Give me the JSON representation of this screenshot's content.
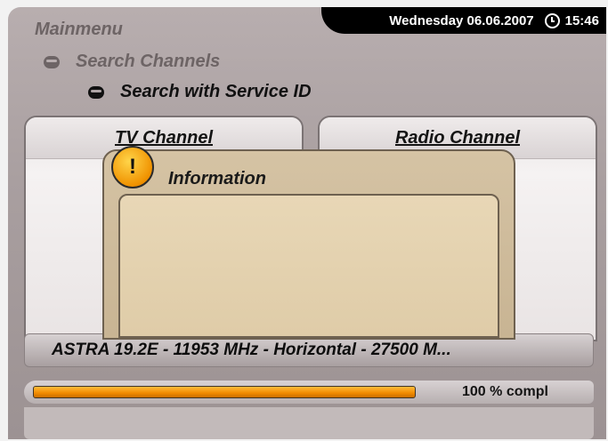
{
  "status_bar": {
    "date": "Wednesday 06.06.2007",
    "time": "15:46",
    "clock_icon": "clock-icon"
  },
  "breadcrumb": {
    "level1": "Mainmenu",
    "level2": "Search Channels",
    "level3": "Search with Service ID"
  },
  "panels": {
    "tv": {
      "label": "TV Channel"
    },
    "radio": {
      "label": "Radio Channel"
    }
  },
  "dialog": {
    "title": "Information",
    "icon": "warning-icon",
    "icon_glyph": "!"
  },
  "satellite": {
    "info": "ASTRA 19.2E - 11953 MHz - Horizontal - 27500 M..."
  },
  "progress": {
    "percent": 100,
    "label": "100 % compl"
  },
  "colors": {
    "accent_orange": "#f08a00",
    "dialog_bg": "#d5c3a4"
  }
}
